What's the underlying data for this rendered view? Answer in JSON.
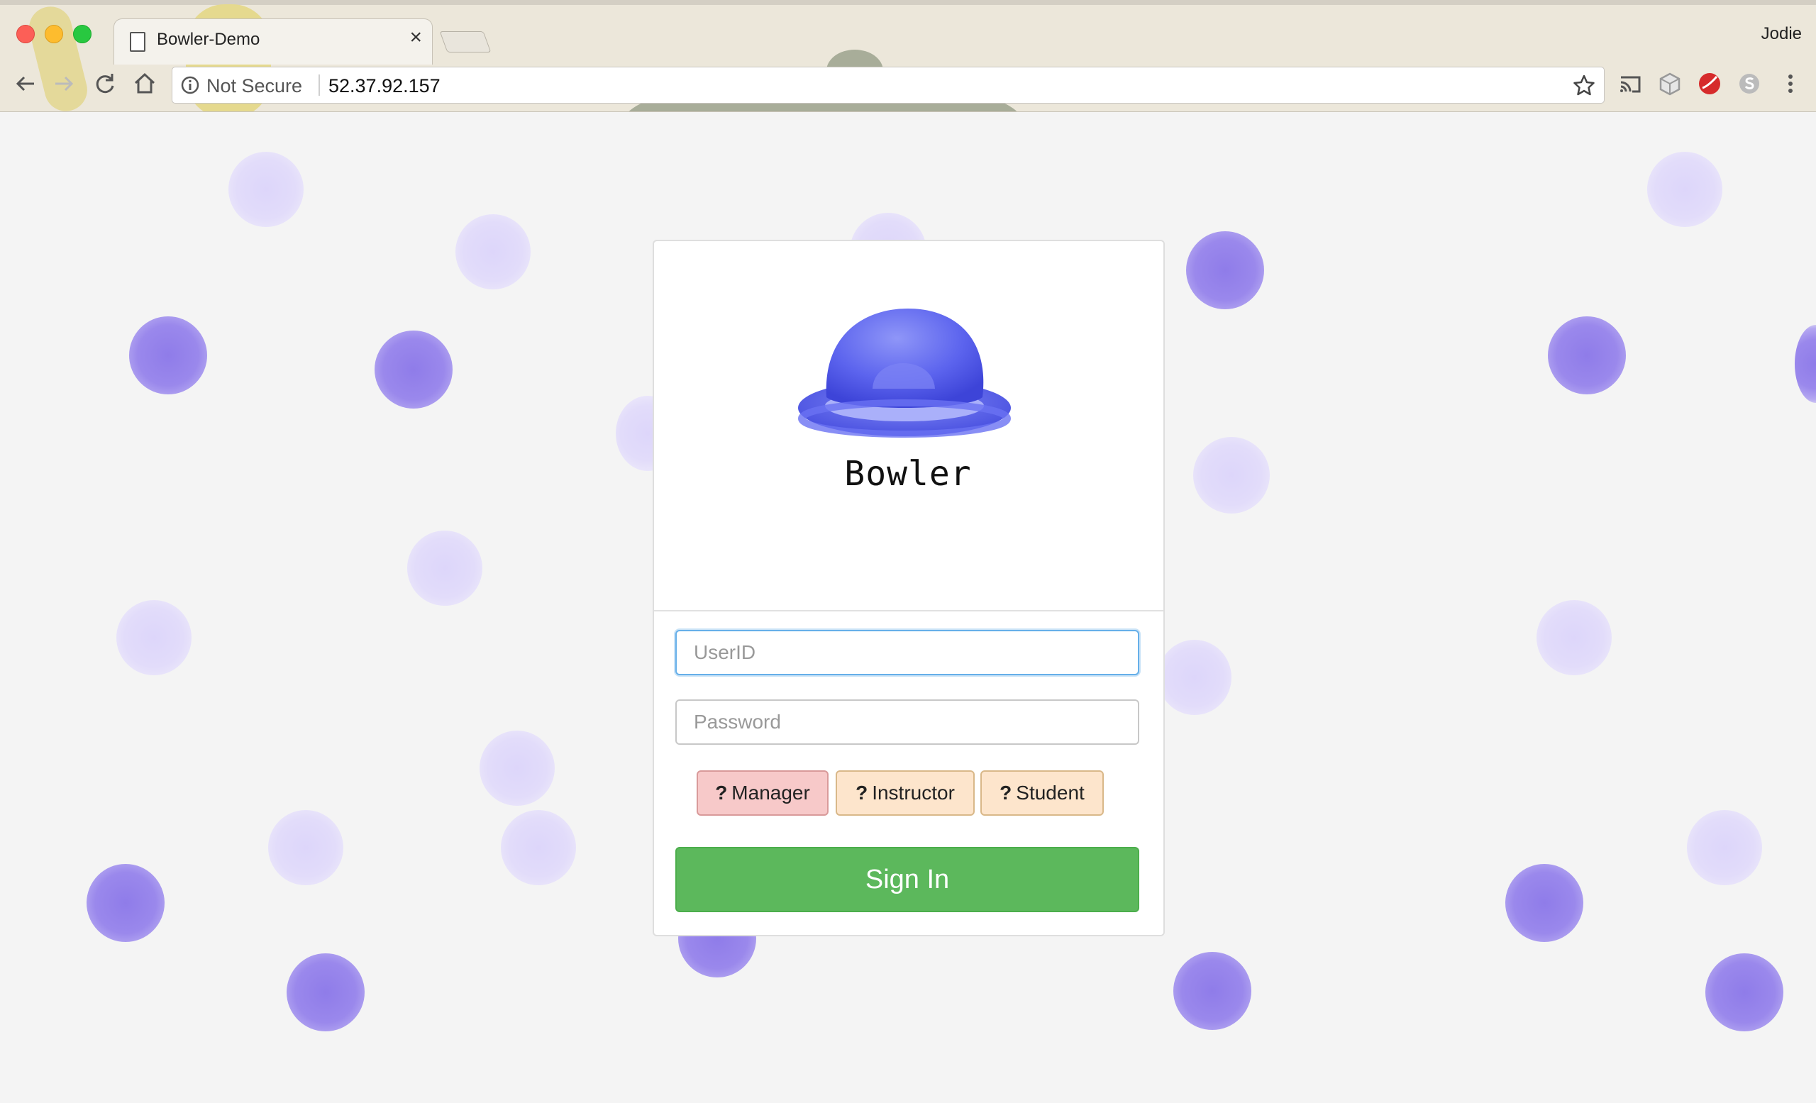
{
  "browser": {
    "tab_title": "Bowler-Demo",
    "tab_close": "×",
    "profile_name": "Jodie",
    "security_label": "Not Secure",
    "url": "52.37.92.157",
    "icons": [
      "back-icon",
      "forward-icon",
      "reload-icon",
      "home-icon",
      "info-icon",
      "star-icon",
      "cast-icon",
      "extension-cube-icon",
      "extension-red-icon",
      "skype-icon",
      "menu-icon"
    ]
  },
  "login": {
    "logo_text": "Bowler",
    "userid_placeholder": "UserID",
    "password_placeholder": "Password",
    "roles": [
      {
        "q": "?",
        "label": "Manager"
      },
      {
        "q": "?",
        "label": "Instructor"
      },
      {
        "q": "?",
        "label": "Student"
      }
    ],
    "signin_label": "Sign In"
  },
  "colors": {
    "accent_green": "#5cb85c",
    "manager_bg": "#f7c9c9",
    "role_bg": "#fde5cc",
    "dot_dark": "#9a88ec",
    "dot_light": "#e2dcfa",
    "logo_blue": "#5c64ee"
  }
}
